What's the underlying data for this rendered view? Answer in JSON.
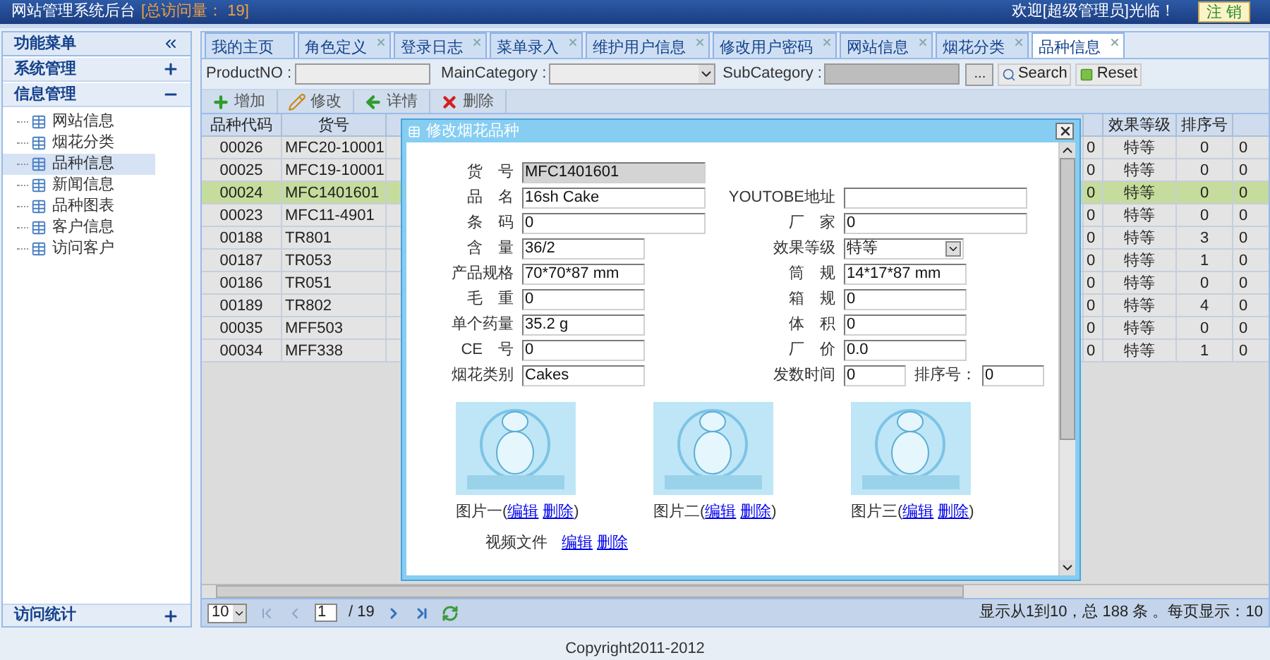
{
  "header": {
    "title": "网站管理系统后台",
    "visits": "[总访问量： 19]",
    "welcome": "欢迎[超级管理员]光临！",
    "logout": "注 销"
  },
  "sidebar": {
    "title": "功能菜单",
    "sections": [
      {
        "label": "系统管理",
        "expanded": false
      },
      {
        "label": "信息管理",
        "expanded": true,
        "items": [
          {
            "label": "网站信息",
            "selected": false
          },
          {
            "label": "烟花分类",
            "selected": false
          },
          {
            "label": "品种信息",
            "selected": true
          },
          {
            "label": "新闻信息",
            "selected": false
          },
          {
            "label": "品种图表",
            "selected": false
          },
          {
            "label": "客户信息",
            "selected": false
          },
          {
            "label": "访问客户",
            "selected": false
          }
        ]
      }
    ],
    "footer_section": {
      "label": "访问统计",
      "expanded": false
    }
  },
  "tabs": [
    {
      "label": "我的主页",
      "closable": false,
      "selected": false
    },
    {
      "label": "角色定义",
      "closable": true,
      "selected": false
    },
    {
      "label": "登录日志",
      "closable": true,
      "selected": false
    },
    {
      "label": "菜单录入",
      "closable": true,
      "selected": false
    },
    {
      "label": "维护用户信息",
      "closable": true,
      "selected": false
    },
    {
      "label": "修改用户密码",
      "closable": true,
      "selected": false
    },
    {
      "label": "网站信息",
      "closable": true,
      "selected": false
    },
    {
      "label": "烟花分类",
      "closable": true,
      "selected": false
    },
    {
      "label": "品种信息",
      "closable": true,
      "selected": true
    }
  ],
  "filter": {
    "product_no": "ProductNO :",
    "main_category": "MainCategory :",
    "sub_category": "SubCategory :",
    "browse": "...",
    "search": "Search",
    "reset": "Reset"
  },
  "toolbar": [
    {
      "kind": "add",
      "label": "增加"
    },
    {
      "kind": "edit",
      "label": "修改"
    },
    {
      "kind": "detail",
      "label": "详情"
    },
    {
      "kind": "delete",
      "label": "删除"
    }
  ],
  "table": {
    "columns": [
      "品种代码",
      "货号",
      "效果等级",
      "排序号"
    ],
    "rows": [
      {
        "code": "00026",
        "no": "MFC20-10001",
        "column_3": "0",
        "grade": "特等",
        "sort": "0",
        "column_6": "0",
        "selected": false
      },
      {
        "code": "00025",
        "no": "MFC19-10001",
        "column_3": "0",
        "grade": "特等",
        "sort": "0",
        "column_6": "0",
        "selected": false
      },
      {
        "code": "00024",
        "no": "MFC1401601",
        "column_3": "0",
        "grade": "特等",
        "sort": "0",
        "column_6": "0",
        "selected": true
      },
      {
        "code": "00023",
        "no": "MFC11-4901",
        "column_3": "0",
        "grade": "特等",
        "sort": "0",
        "column_6": "0",
        "selected": false
      },
      {
        "code": "00188",
        "no": "TR801",
        "column_3": "0",
        "grade": "特等",
        "sort": "3",
        "column_6": "0",
        "selected": false
      },
      {
        "code": "00187",
        "no": "TR053",
        "column_3": "0",
        "grade": "特等",
        "sort": "1",
        "column_6": "0",
        "selected": false
      },
      {
        "code": "00186",
        "no": "TR051",
        "column_3": "0",
        "grade": "特等",
        "sort": "0",
        "column_6": "0",
        "selected": false
      },
      {
        "code": "00189",
        "no": "TR802",
        "column_3": "0",
        "grade": "特等",
        "sort": "4",
        "column_6": "0",
        "selected": false
      },
      {
        "code": "00035",
        "no": "MFF503",
        "column_3": "0",
        "grade": "特等",
        "sort": "0",
        "column_6": "0",
        "selected": false
      },
      {
        "code": "00034",
        "no": "MFF338",
        "column_3": "0",
        "grade": "特等",
        "sort": "1",
        "column_6": "0",
        "selected": false
      }
    ]
  },
  "pager": {
    "page_size": "10",
    "page": "1",
    "total_pages": "/ 19",
    "info": "显示从1到10，总 188 条 。每页显示：10"
  },
  "dialog": {
    "title": "修改烟花品种",
    "rows": [
      {
        "left": {
          "label": "货　号",
          "value": "MFC1401601",
          "kind": "input",
          "disabled": true
        }
      },
      {
        "left": {
          "label": "品　名",
          "value": "16sh Cake",
          "kind": "input",
          "disabled": false
        },
        "right": {
          "label": "YOUTOBE地址",
          "kind": "input",
          "disabled": false
        }
      },
      {
        "left": {
          "label": "条　码",
          "value": "0",
          "kind": "input",
          "disabled": false
        },
        "right": {
          "label": "厂　家",
          "value": "0",
          "kind": "input",
          "disabled": false
        }
      },
      {
        "left": {
          "label": "含　量",
          "value": "36/2",
          "kind": "input",
          "disabled": false
        },
        "right": {
          "label": "效果等级",
          "value": "特等",
          "kind": "select",
          "disabled": false
        }
      },
      {
        "left": {
          "label": "产品规格",
          "value": "70*70*87 mm",
          "kind": "input",
          "disabled": false
        },
        "right": {
          "label": "筒　规",
          "value": "14*17*87 mm",
          "kind": "input",
          "disabled": false
        }
      },
      {
        "left": {
          "label": "毛　重",
          "value": "0",
          "kind": "input",
          "disabled": false
        },
        "right": {
          "label": "箱　规",
          "value": "0",
          "kind": "input",
          "disabled": false
        }
      },
      {
        "left": {
          "label": "单个药量",
          "value": "35.2 g",
          "kind": "input",
          "disabled": false
        },
        "right": {
          "label": "体　积",
          "value": "0",
          "kind": "input",
          "disabled": false
        }
      },
      {
        "left": {
          "label": "CE　号",
          "value": "0",
          "kind": "input",
          "disabled": false
        },
        "right": {
          "label": "厂　价",
          "value": "0.0",
          "kind": "input",
          "disabled": false
        }
      },
      {
        "left": {
          "label": "烟花类别",
          "value": "Cakes",
          "kind": "input",
          "disabled": false
        },
        "right": {
          "label": "发数时间",
          "value": "0",
          "kind": "pair",
          "extra_label": "排序号：",
          "extra_value": "0",
          "disabled": false
        }
      }
    ],
    "images": [
      {
        "prefix": "图片一(",
        "links": [
          "编辑",
          "删除"
        ],
        "suffix": ")"
      },
      {
        "prefix": "图片二(",
        "links": [
          "编辑",
          "删除"
        ],
        "suffix": ")"
      },
      {
        "prefix": "图片三(",
        "links": [
          "编辑",
          "删除"
        ],
        "suffix": ")"
      }
    ],
    "video": {
      "label": "视频文件",
      "links": [
        "编辑",
        "删除"
      ]
    }
  },
  "copyright": "Copyright2011-2012"
}
